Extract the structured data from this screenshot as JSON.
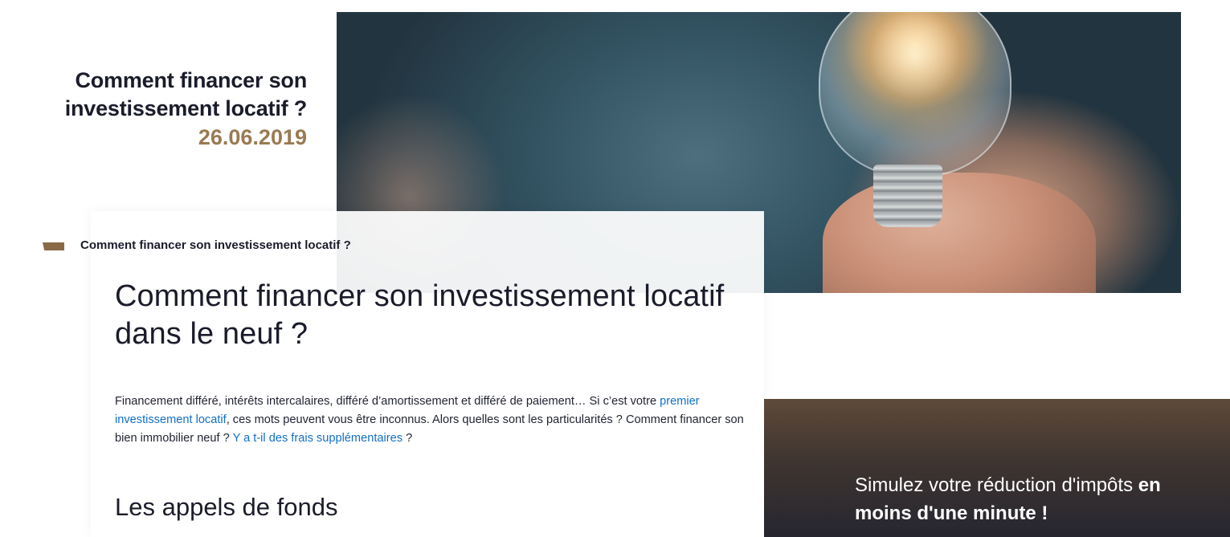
{
  "header": {
    "title": "Comment financer son investissement locatif ?",
    "date": "26.06.2019"
  },
  "hero": {
    "image_description_icon": "lightbulb-in-hand-icon"
  },
  "breadcrumb": {
    "label": "Comment financer son investissement locatif ?"
  },
  "article": {
    "title": "Comment financer son investissement locatif dans le neuf ?",
    "intro": {
      "part1": "Financement différé, intérêts intercalaires, différé d’amortissement et différé de paiement… Si c’est votre ",
      "link1": "premier investissement locatif",
      "part2": ", ces mots peuvent vous être inconnus. Alors quelles sont les particularités ? Comment financer son bien immobilier neuf ? ",
      "link2": "Y a t-il des frais supplémentaires",
      "part3": " ?"
    },
    "section_title": "Les appels de fonds"
  },
  "cta": {
    "text_normal": "Simulez votre réduction d'impôts ",
    "text_bold": "en moins d'une minute !"
  },
  "colors": {
    "title": "#1a1c2b",
    "date": "#9a7a52",
    "link": "#1170c4",
    "accent_marker": "#8a6a46"
  }
}
